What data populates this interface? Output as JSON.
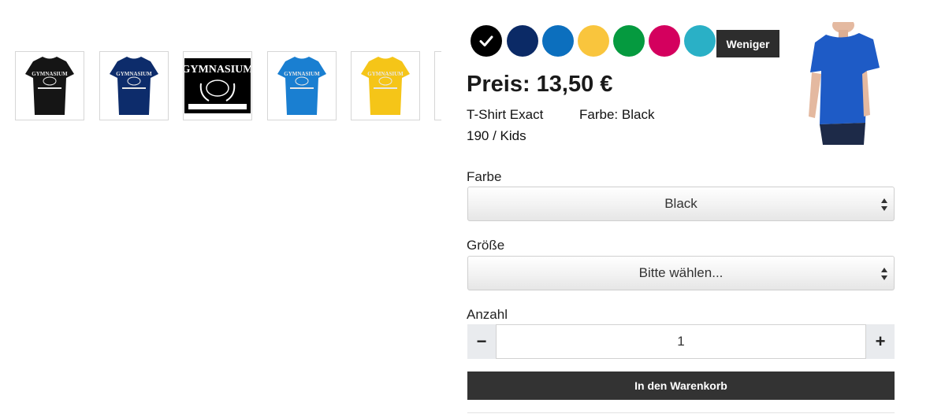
{
  "thumbnails": [
    {
      "color_name": "Black",
      "color": "#151515",
      "print": "#e8e8e8",
      "print_text": "GYMNASIUM"
    },
    {
      "color_name": "Navy",
      "color": "#0d2c6b",
      "print": "#e8e8e8",
      "print_text": "GYMNASIUM"
    },
    {
      "color_name": "Print",
      "color": "#000000",
      "print": "#ffffff",
      "print_text": "GYMNASIUM"
    },
    {
      "color_name": "Blue",
      "color": "#1a7fd1",
      "print": "#e8e8e8",
      "print_text": "GYMNASIUM"
    },
    {
      "color_name": "Yellow",
      "color": "#f5c518",
      "print": "#e8e8e8",
      "print_text": "GYMNASIUM"
    }
  ],
  "swatches": [
    {
      "name": "Black",
      "color": "#000000",
      "selected": true
    },
    {
      "name": "Navy",
      "color": "#0b2a66",
      "selected": false
    },
    {
      "name": "Blue",
      "color": "#0c6fbe",
      "selected": false
    },
    {
      "name": "Yellow",
      "color": "#f9c53d",
      "selected": false
    },
    {
      "name": "Green",
      "color": "#059a3f",
      "selected": false
    },
    {
      "name": "Pink",
      "color": "#d4005e",
      "selected": false
    },
    {
      "name": "Turquoise",
      "color": "#2ab0c6",
      "selected": false
    }
  ],
  "less_button": "Weniger",
  "price": "Preis: 13,50 €",
  "product": {
    "name": "T-Shirt Exact",
    "size_line": "190 / Kids",
    "color_label": "Farbe:",
    "color_value": "Black"
  },
  "color_select": {
    "label": "Farbe",
    "value": "Black"
  },
  "size_select": {
    "label": "Größe",
    "value": "Bitte wählen..."
  },
  "quantity": {
    "label": "Anzahl",
    "value": "1",
    "minus": "−",
    "plus": "+"
  },
  "cart_button": "In den Warenkorb",
  "colors": {
    "accent": "#333333",
    "model_shirt": "#1e5bc6"
  }
}
